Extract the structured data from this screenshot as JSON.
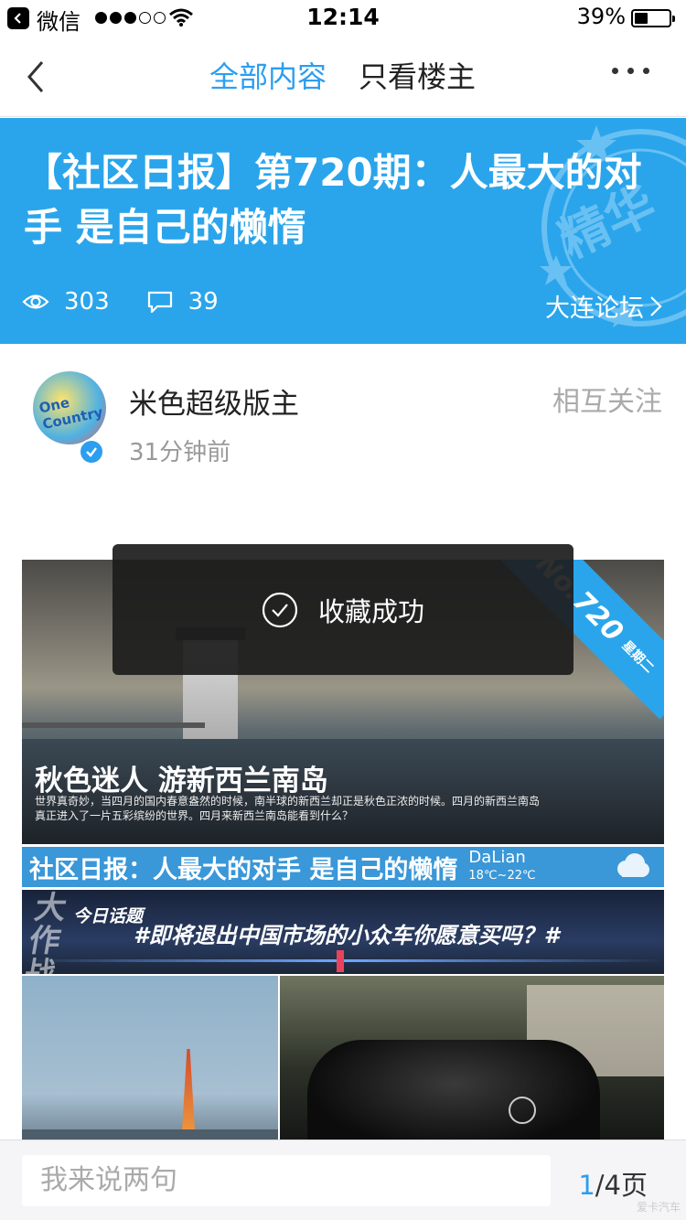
{
  "status_bar": {
    "carrier": "微信",
    "time": "12:14",
    "battery": "39%",
    "battery_level": 0.39
  },
  "nav": {
    "tab_all": "全部内容",
    "tab_op_only": "只看楼主"
  },
  "banner": {
    "title": "【社区日报】第720期：人最大的对手 是自己的懒惰",
    "views": "303",
    "comments": "39",
    "forum": "大连论坛",
    "seal_text": "精华"
  },
  "author": {
    "name": "米色超级版主",
    "time": "31分钟前",
    "follow_label": "相互关注",
    "avatar_text": "One Country"
  },
  "post_image": {
    "ribbon_no": "No.720",
    "ribbon_day": "星期二",
    "scene_title": "秋色迷人 游新西兰南岛",
    "scene_desc": "世界真奇妙，当四月的国内春意盎然的时候，南半球的新西兰却正是秋色正浓的时候。四月的新西兰南岛真正进入了一片五彩缤纷的世界。四月来新西兰南岛能看到什么？",
    "daily_title": "社区日报：人最大的对手 是自己的懒惰",
    "city": "DaLian",
    "temperature": "18℃~22℃",
    "topic_big": "大作战",
    "topic_label": "今日话题",
    "topic_text": "#即将退出中国市场的小众车你愿意买吗？#"
  },
  "toast": {
    "text": "收藏成功"
  },
  "bottom": {
    "reply_placeholder": "我来说两句",
    "page_current": "1",
    "page_total": "/4页",
    "watermark": "爱卡汽车"
  }
}
